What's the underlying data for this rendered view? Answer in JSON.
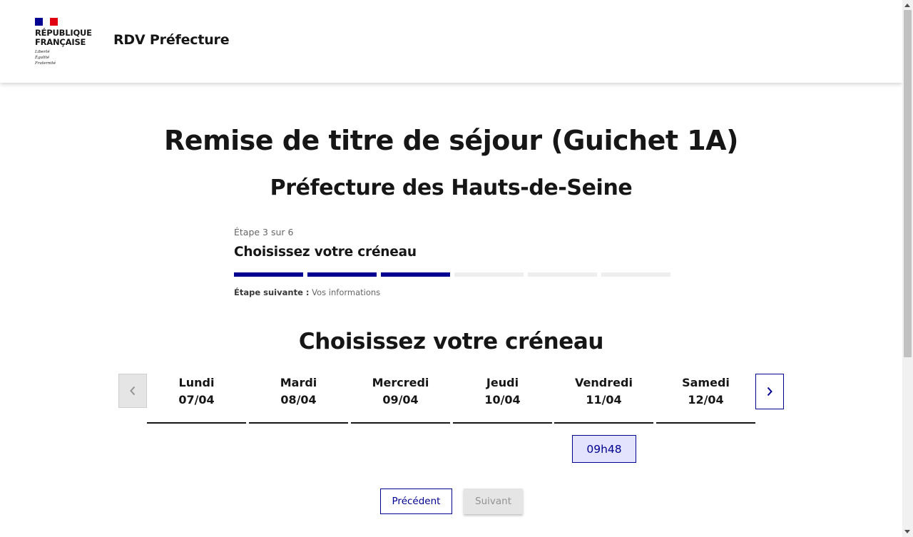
{
  "header": {
    "logo_lines": [
      "RÉPUBLIQUE",
      "FRANÇAISE"
    ],
    "devise": [
      "Liberté",
      "Égalité",
      "Fraternité"
    ],
    "service_title": "RDV Préfecture"
  },
  "page": {
    "title": "Remise de titre de séjour (Guichet 1A)",
    "subtitle": "Préfecture des Hauts-de-Seine"
  },
  "stepper": {
    "step_count": "Étape 3 sur 6",
    "current_step": 3,
    "total_steps": 6,
    "title": "Choisissez votre créneau",
    "next_label": "Étape suivante :",
    "next_value": "Vos informations"
  },
  "calendar": {
    "title": "Choisissez votre créneau",
    "days": [
      {
        "name": "Lundi",
        "date": "07/04"
      },
      {
        "name": "Mardi",
        "date": "08/04"
      },
      {
        "name": "Mercredi",
        "date": "09/04"
      },
      {
        "name": "Jeudi",
        "date": "10/04"
      },
      {
        "name": "Vendredi",
        "date": "11/04"
      },
      {
        "name": "Samedi",
        "date": "12/04"
      }
    ],
    "slot": {
      "day": "Vendredi",
      "time": "09h48"
    }
  },
  "actions": {
    "previous": "Précédent",
    "next": "Suivant"
  },
  "colors": {
    "accent": "#000091",
    "flag_blue": "#000091",
    "flag_red": "#e1000f",
    "disabled_bg": "#e5e5e5",
    "slot_bg": "#e3e3fd"
  }
}
